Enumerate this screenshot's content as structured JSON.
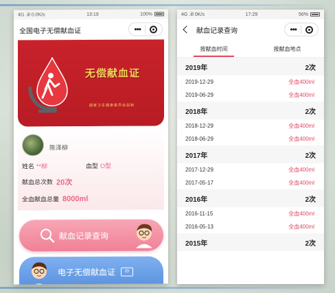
{
  "left": {
    "status": {
      "left": "4G .ill 0.0K/s",
      "time": "13:19",
      "right": "100%"
    },
    "nav_title": "全国电子无偿献血证",
    "banner": {
      "title": "无偿献血证",
      "subtitle": "国家卫生健康委员会监制"
    },
    "user": {
      "name": "陈泽柳",
      "fields": [
        {
          "label": "姓名",
          "value": "**柳"
        },
        {
          "label": "血型",
          "value": "O型"
        }
      ],
      "count_label": "献血总次数",
      "count_value": "20次",
      "total_label": "全血献血总量",
      "total_value": "8000ml"
    },
    "btn_query": "献血记录查询",
    "btn_cert": "电子无偿献血证",
    "cert_icon_text": "ID"
  },
  "right": {
    "status": {
      "left": "4G .ill 0K/s",
      "time": "17:29",
      "right": "56%"
    },
    "nav_title": "献血记录查询",
    "tabs": [
      "按献血时间",
      "按献血地点"
    ],
    "groups": [
      {
        "year": "2019年",
        "count": "2次",
        "records": [
          {
            "date": "2019-12-29",
            "amount": "全血400ml"
          },
          {
            "date": "2019-06-29",
            "amount": "全血400ml"
          }
        ]
      },
      {
        "year": "2018年",
        "count": "2次",
        "records": [
          {
            "date": "2018-12-29",
            "amount": "全血400ml"
          },
          {
            "date": "2018-06-29",
            "amount": "全血400ml"
          }
        ]
      },
      {
        "year": "2017年",
        "count": "2次",
        "records": [
          {
            "date": "2017-12-29",
            "amount": "全血400ml"
          },
          {
            "date": "2017-05-17",
            "amount": "全血400ml"
          }
        ]
      },
      {
        "year": "2016年",
        "count": "2次",
        "records": [
          {
            "date": "2016-11-15",
            "amount": "全血400ml"
          },
          {
            "date": "2016-05-13",
            "amount": "全血400ml"
          }
        ]
      },
      {
        "year": "2015年",
        "count": "2次",
        "records": []
      }
    ]
  },
  "colors": {
    "accent": "#e0475f",
    "banner": "#c8222b",
    "query_btn": "#f08197",
    "cert_btn": "#5b92df"
  }
}
